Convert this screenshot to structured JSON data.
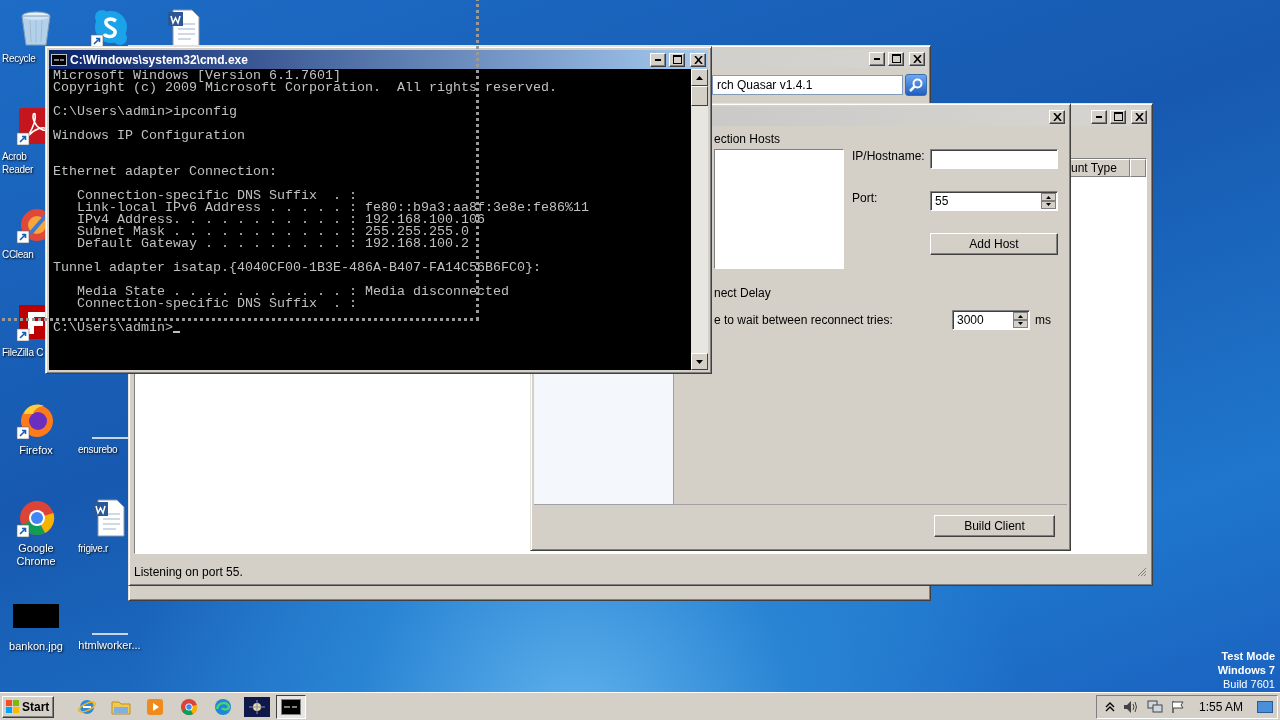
{
  "desktop_icons": [
    {
      "kind": "recycle-bin",
      "label": "Recycle",
      "shortcut": false
    },
    {
      "kind": "chat-app",
      "shortcut": true
    },
    {
      "kind": "document",
      "shortcut": false
    },
    {
      "kind": "pdf-reader",
      "label": "Acrob Reader",
      "shortcut": true
    },
    {
      "kind": "brush",
      "label": "CClean",
      "shortcut": true
    },
    {
      "kind": "ftp-app",
      "label": "FileZilla C",
      "shortcut": true
    },
    {
      "kind": "fox-browser",
      "label": "Firefox",
      "shortcut": true
    },
    {
      "kind": "blank-file",
      "label": "ensurebo"
    },
    {
      "kind": "ring-browser",
      "label": "Google Chrome",
      "shortcut": true
    },
    {
      "kind": "document",
      "label": "frigive.r",
      "shortcut": false
    },
    {
      "kind": "image-file",
      "label": "bankon.jpg",
      "shortcut": false
    },
    {
      "kind": "blank-file",
      "label": "htmlworker..."
    }
  ],
  "desktop_notice": [
    "Test Mode",
    "Windows 7",
    "Build 7601"
  ],
  "search_window": {
    "active": false,
    "caption_buttons": [
      {
        "kind": "minimize"
      },
      {
        "kind": "maximize"
      },
      {
        "kind": "close"
      }
    ],
    "search_value": "rch Quasar v1.4.1"
  },
  "main_window": {
    "active": false,
    "caption_buttons": [
      {
        "kind": "minimize"
      },
      {
        "kind": "maximize"
      },
      {
        "kind": "close"
      }
    ],
    "columns": [
      "unt Type"
    ],
    "status": "Listening on port 55."
  },
  "builder_window": {
    "active": false,
    "caption_buttons": [
      {
        "kind": "close"
      }
    ],
    "hosts_label": "ection Hosts",
    "ip_label": "IP/Hostname:",
    "port_label": "Port:",
    "port_value": "55",
    "add_host": "Add Host",
    "delay_heading": "nect Delay",
    "delay_label": "e to wait between reconnect tries:",
    "delay_value": "3000",
    "delay_unit": "ms",
    "build": "Build Client"
  },
  "cmd_window": {
    "active": true,
    "title": "C:\\Windows\\system32\\cmd.exe",
    "caption_buttons": [
      {
        "kind": "minimize"
      },
      {
        "kind": "maximize"
      },
      {
        "kind": "close"
      }
    ],
    "blocks": [
      {
        "kind": "plain",
        "lines": [
          "Microsoft Windows [Version 6.1.7601]",
          "Copyright (c) 2009 Microsoft Corporation.  All rights reserved."
        ]
      },
      {
        "kind": "plain",
        "lines": [
          "C:\\Users\\admin>ipconfig"
        ]
      },
      {
        "kind": "spaced",
        "lines": [
          "Windows IP Configuration"
        ]
      },
      {
        "kind": "plain",
        "lines": [
          "Ethernet adapter Connection:"
        ]
      },
      {
        "kind": "plain",
        "lines": [
          "   Connection-specific DNS Suffix  . :",
          "   Link-local IPv6 Address . . . . . : fe80::b9a3:aa8f:3e8e:fe86%11",
          "   IPv4 Address. . . . . . . . . . . : 192.168.100.106",
          "   Subnet Mask . . . . . . . . . . . : 255.255.255.0",
          "   Default Gateway . . . . . . . . . : 192.168.100.2"
        ]
      },
      {
        "kind": "plain",
        "lines": [
          "Tunnel adapter isatap.{4040CF00-1B3E-486A-B407-FA14C56B6FC0}:"
        ]
      },
      {
        "kind": "plain",
        "lines": [
          "   Media State . . . . . . . . . . . : Media disconnected",
          "   Connection-specific DNS Suffix  . :"
        ]
      },
      {
        "kind": "prompt",
        "lines": [
          "C:\\Users\\admin>"
        ],
        "cursor": true
      }
    ]
  },
  "taskbar": {
    "start": "Start",
    "apps": [
      {
        "kind": "ie",
        "selected": false
      },
      {
        "kind": "folder",
        "selected": false
      },
      {
        "kind": "media",
        "selected": false
      },
      {
        "kind": "ring-browser",
        "selected": false
      },
      {
        "kind": "wave-browser",
        "selected": false
      },
      {
        "kind": "server-app",
        "selected": false
      },
      {
        "kind": "console",
        "selected": true
      }
    ],
    "tray_icons": [
      {
        "kind": "chevron"
      },
      {
        "kind": "speaker"
      },
      {
        "kind": "network"
      },
      {
        "kind": "flag"
      }
    ],
    "time": "1:55 AM"
  }
}
